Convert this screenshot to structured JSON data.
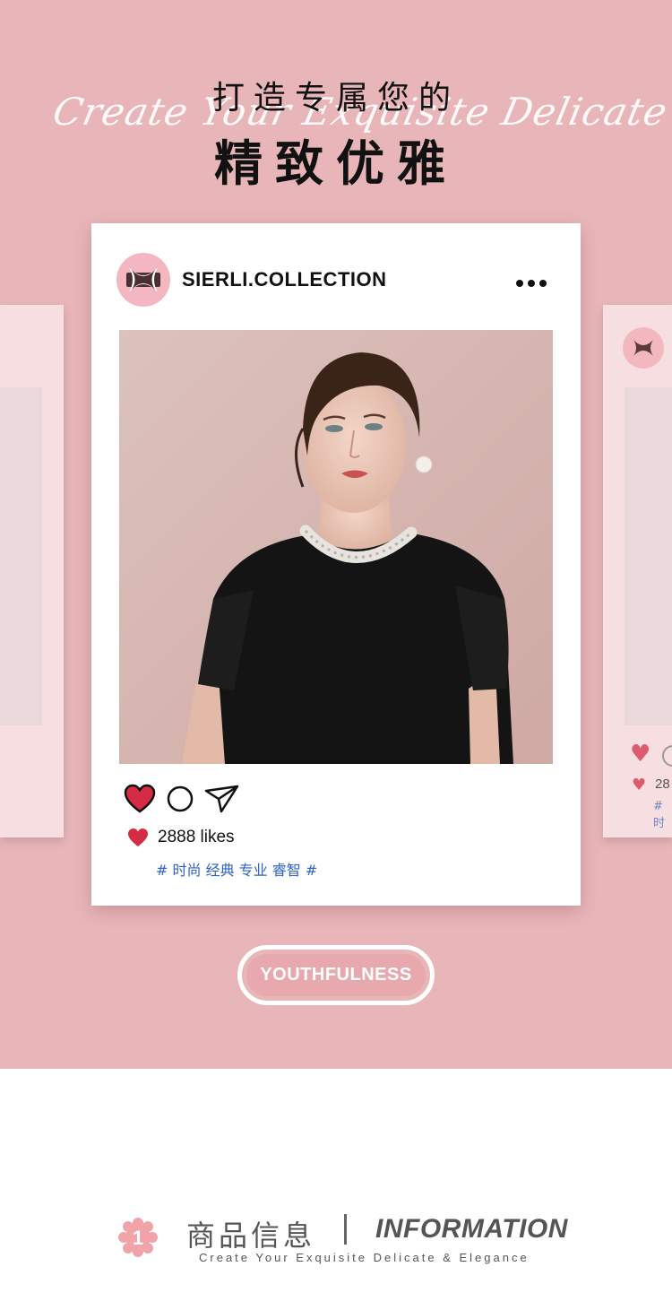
{
  "hero": {
    "title_line1": "打造专属您的",
    "title_line2": "精致优雅",
    "script_text": "Create Your Exquisite Delicate & Elegance",
    "background_color": "#e8b6b9"
  },
  "post": {
    "handle": "SIERLI.COLLECTION",
    "likes": "2888 likes",
    "tags": "# 时尚 经典 专业 睿智 #",
    "avatar_icon": "brand-logo-icon",
    "heart_color": "#d62b45",
    "tag_color": "#2e62c4"
  },
  "side_post": {
    "likes_partial": "28",
    "tag_partial": "# 时"
  },
  "badge": {
    "label": "YOUTHFULNESS"
  },
  "info": {
    "number": "1",
    "title_cn": "商品信息",
    "title_en": "INFORMATION",
    "subtitle": "Create Your Exquisite Delicate & Elegance"
  }
}
